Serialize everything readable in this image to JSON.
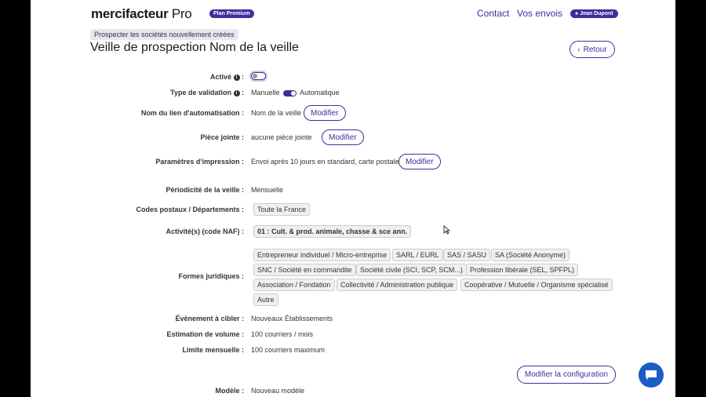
{
  "header": {
    "logo_main": "mercifacteur",
    "logo_pro": " Pro",
    "plan_badge": "Plan Premium",
    "nav": {
      "contact": "Contact",
      "envois": "Vos envois"
    },
    "user": "Jean Dupont"
  },
  "breadcrumb": "Prospecter les sociétés nouvellement créées",
  "title": "Veille de prospection Nom de la veille",
  "back_label": "Retour",
  "fields": {
    "active_label": "Activé",
    "validation_label": "Type de validation",
    "validation_manual": "Manuelle",
    "validation_auto": "Automatique",
    "link_name_label": "Nom du lien d'automatisation :",
    "link_name_value": "Nom de la veille",
    "attachment_label": "Pièce jointe :",
    "attachment_value": "aucune pièce jointe",
    "print_label": "Paramètres d'impression :",
    "print_value": "Envoi après 10 jours en standard, carte postale.",
    "periodicity_label": "Périodicité de la veille :",
    "periodicity_value": "Mensuelle",
    "zip_label": "Codes postaux / Départements :",
    "zip_value": "Toute la France",
    "naf_label": "Activité(s) (code NAF) :",
    "naf_value": "01 : Cult. & prod. animale, chasse & sce ann.",
    "forms_label": "Formes juridiques :",
    "forms": [
      "Entrepreneur individuel / Micro-entreprise",
      "SARL / EURL",
      "SAS / SASU",
      "SA (Société Anonyme)",
      "SNC / Société en commandite",
      "Société civile (SCI, SCP, SCM...)",
      "Profession libérale (SEL, SPFPL)",
      "Association / Fondation",
      "Collectivité / Administration publique",
      "Coopérative / Mutuelle / Organisme spécialisé",
      "Autre"
    ],
    "event_label": "Évènement à cibler :",
    "event_value": "Nouveaux Établissements",
    "volume_label": "Estimation de volume :",
    "volume_value": "100 courriers / mois",
    "limit_label": "Limite mensuelle :",
    "limit_value": "100 courriers maximum",
    "model_label": "Modèle :",
    "model_value": "Nouveau modèle"
  },
  "modify_label": "Modifier",
  "config_label": "Modifier la configuration",
  "colors": {
    "accent": "#3b2f9e",
    "chat": "#1a5dc4"
  },
  "toggles": {
    "active": false,
    "validation_automatic": true
  },
  "icons": [
    "info-icon",
    "chevron-left-icon",
    "user-icon",
    "chat-icon",
    "mouse-cursor-icon"
  ]
}
